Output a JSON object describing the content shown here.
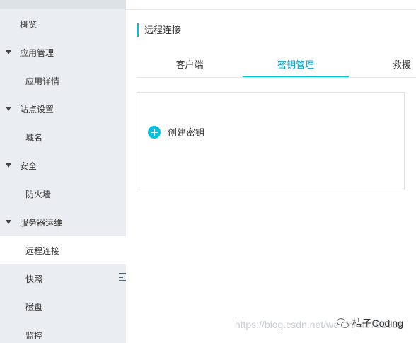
{
  "sidebar": {
    "items": [
      {
        "label": "概览",
        "type": "top",
        "expanded": false,
        "active": false
      },
      {
        "label": "应用管理",
        "type": "group",
        "expanded": true,
        "active": false
      },
      {
        "label": "应用详情",
        "type": "sub",
        "active": false
      },
      {
        "label": "站点设置",
        "type": "group",
        "expanded": true,
        "active": false
      },
      {
        "label": "域名",
        "type": "sub",
        "active": false
      },
      {
        "label": "安全",
        "type": "group",
        "expanded": true,
        "active": false
      },
      {
        "label": "防火墙",
        "type": "sub",
        "active": false
      },
      {
        "label": "服务器运维",
        "type": "group",
        "expanded": true,
        "active": false
      },
      {
        "label": "远程连接",
        "type": "sub",
        "active": true
      },
      {
        "label": "快照",
        "type": "sub",
        "active": false
      },
      {
        "label": "磁盘",
        "type": "sub",
        "active": false
      },
      {
        "label": "监控",
        "type": "sub",
        "active": false
      }
    ]
  },
  "page": {
    "title": "远程连接"
  },
  "tabs": [
    {
      "label": "客户端",
      "active": false
    },
    {
      "label": "密钥管理",
      "active": true
    },
    {
      "label": "救援",
      "active": false
    }
  ],
  "card": {
    "create_label": "创建密钥",
    "create_icon": "plus-circle-icon"
  },
  "overlay": {
    "watermark": "https://blog.csdn.net/weixin_43751831",
    "brand": "桔子Coding",
    "brand_icon": "wechat-icon"
  },
  "colors": {
    "accent": "#00c1de",
    "active_text": "#00a2ca",
    "sidebar_bg": "#eaedf1"
  }
}
